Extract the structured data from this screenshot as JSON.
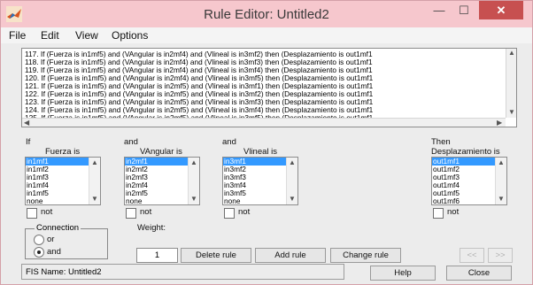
{
  "window": {
    "title": "Rule Editor: Untitled2",
    "min": "—",
    "max": "☐",
    "close": "✕"
  },
  "menu": [
    "File",
    "Edit",
    "View",
    "Options"
  ],
  "rules": [
    "117. If (Fuerza is in1mf5) and (VAngular is in2mf4) and (Vlineal is in3mf2) then (Desplazamiento is out1mf1",
    "118. If (Fuerza is in1mf5) and (VAngular is in2mf4) and (Vlineal is in3mf3) then (Desplazamiento is out1mf1",
    "119. If (Fuerza is in1mf5) and (VAngular is in2mf4) and (Vlineal is in3mf4) then (Desplazamiento is out1mf1",
    "120. If (Fuerza is in1mf5) and (VAngular is in2mf4) and (Vlineal is in3mf5) then (Desplazamiento is out1mf1",
    "121. If (Fuerza is in1mf5) and (VAngular is in2mf5) and (Vlineal is in3mf1) then (Desplazamiento is out1mf1",
    "122. If (Fuerza is in1mf5) and (VAngular is in2mf5) and (Vlineal is in3mf2) then (Desplazamiento is out1mf1",
    "123. If (Fuerza is in1mf5) and (VAngular is in2mf5) and (Vlineal is in3mf3) then (Desplazamiento is out1mf1",
    "124. If (Fuerza is in1mf5) and (VAngular is in2mf5) and (Vlineal is in3mf4) then (Desplazamiento is out1mf1",
    "125. If (Fuerza is in1mf5) and (VAngular is in2mf5) and (Vlineal is in3mf5) then (Desplazamiento is out1mf1"
  ],
  "columns": [
    {
      "pre": "If",
      "var": "Fuerza is",
      "items": [
        "in1mf1",
        "in1mf2",
        "in1mf3",
        "in1mf4",
        "in1mf5",
        "none"
      ],
      "not": "not"
    },
    {
      "pre": "and",
      "var": "VAngular is",
      "items": [
        "in2mf1",
        "in2mf2",
        "in2mf3",
        "in2mf4",
        "in2mf5",
        "none"
      ],
      "not": "not"
    },
    {
      "pre": "and",
      "var": "Vlineal is",
      "items": [
        "in3mf1",
        "in3mf2",
        "in3mf3",
        "in3mf4",
        "in3mf5",
        "none"
      ],
      "not": "not"
    },
    {
      "pre": "Then",
      "var": "Desplazamiento is",
      "items": [
        "out1mf1",
        "out1mf2",
        "out1mf3",
        "out1mf4",
        "out1mf5",
        "out1mf6"
      ],
      "not": "not"
    }
  ],
  "connection": {
    "label": "Connection",
    "or": "or",
    "and": "and",
    "selected": "and"
  },
  "weight": {
    "label": "Weight:",
    "value": "1"
  },
  "buttons": {
    "delete": "Delete rule",
    "add": "Add rule",
    "change": "Change rule",
    "prev": "<<",
    "next": ">>",
    "help": "Help",
    "close": "Close"
  },
  "status": "FIS Name: Untitled2",
  "colors": {
    "titlebar": "#f6c7cd",
    "selection": "#3399ff",
    "close": "#c75050"
  }
}
